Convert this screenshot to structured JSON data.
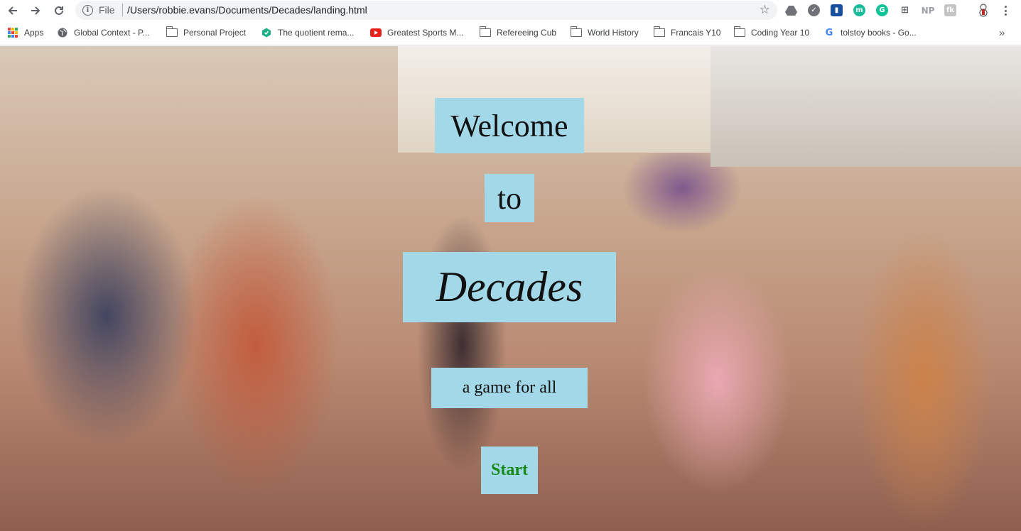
{
  "browser": {
    "url_scheme": "File",
    "url": "/Users/robbie.evans/Documents/Decades/landing.html",
    "extensions": [
      {
        "icon": "drive-icon",
        "color": "#5f6368"
      },
      {
        "icon": "shield-icon",
        "color": "#5f6368"
      },
      {
        "icon": "book-icon",
        "color": "#1a4fa0"
      },
      {
        "icon": "m-icon",
        "color": "#1abc9c",
        "label": "m"
      },
      {
        "icon": "grammarly-icon",
        "color": "#15c39a",
        "label": "G"
      },
      {
        "icon": "grid-icon",
        "color": "#5f6368"
      },
      {
        "icon": "np-icon",
        "color": "#9aa0a6",
        "label": "NP"
      },
      {
        "icon": "fk-icon",
        "color": "#b0b0b0",
        "label": "fk"
      },
      {
        "icon": "snowman-icon",
        "color": "#c62828"
      }
    ]
  },
  "bookmarks": [
    {
      "label": "Apps",
      "icon": "apps-grid-icon"
    },
    {
      "label": "Global Context - P...",
      "icon": "globe-icon"
    },
    {
      "label": "Personal Project",
      "icon": "folder-icon"
    },
    {
      "label": "The quotient rema...",
      "icon": "hex-site-icon"
    },
    {
      "label": "Greatest Sports M...",
      "icon": "youtube-icon"
    },
    {
      "label": "Refereeing Cub",
      "icon": "folder-icon"
    },
    {
      "label": "World History",
      "icon": "folder-icon"
    },
    {
      "label": "Francais Y10",
      "icon": "folder-icon"
    },
    {
      "label": "Coding Year 10",
      "icon": "folder-icon"
    },
    {
      "label": "tolstoy books - Go...",
      "icon": "google-icon"
    }
  ],
  "landing": {
    "welcome": "Welcome",
    "to": "to",
    "title": "Decades",
    "tagline": "a game for all",
    "start_label": "Start",
    "panel_color": "#a3d8e8",
    "start_color": "#168a16"
  }
}
